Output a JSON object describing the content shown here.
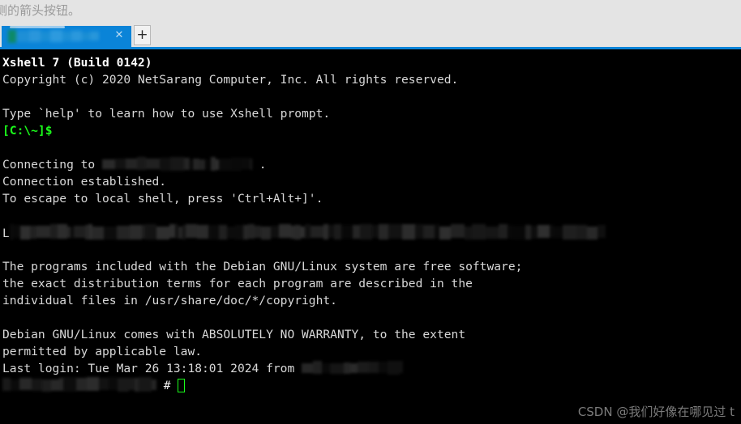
{
  "page_header": {
    "text": "侧的箭头按钮。"
  },
  "tabbar": {
    "tab": {
      "label": "",
      "close_icon": "✕"
    },
    "new_tab_label": "+",
    "accent_color": "#0a84d8"
  },
  "terminal": {
    "background_color": "#000000",
    "foreground_color": "#d8d8d8",
    "prompt_color": "#1bfc1b",
    "lines": [
      {
        "id": "l1",
        "text": "Xshell 7 (Build 0142)",
        "style": "bold"
      },
      {
        "id": "l2",
        "text": "Copyright (c) 2020 NetSarang Computer, Inc. All rights reserved.",
        "style": "normal"
      },
      {
        "id": "l3",
        "text": "",
        "style": "blank"
      },
      {
        "id": "l4",
        "text": "Type `help' to learn how to use Xshell prompt.",
        "style": "normal"
      },
      {
        "id": "l5",
        "text": "[C:\\~]$",
        "style": "green"
      },
      {
        "id": "l6",
        "text": "",
        "style": "blank"
      },
      {
        "id": "l7",
        "prefix": "Connecting to ",
        "redacted": true,
        "suffix": " .",
        "style": "normal"
      },
      {
        "id": "l8",
        "text": "Connection established.",
        "style": "normal"
      },
      {
        "id": "l9",
        "text": "To escape to local shell, press 'Ctrl+Alt+]'.",
        "style": "normal"
      },
      {
        "id": "l10",
        "text": "",
        "style": "blank"
      },
      {
        "id": "l11",
        "prefix": "L",
        "redacted": true,
        "suffix": "",
        "style": "normal"
      },
      {
        "id": "l12",
        "text": "",
        "style": "blank"
      },
      {
        "id": "l13",
        "text": "The programs included with the Debian GNU/Linux system are free software;",
        "style": "normal"
      },
      {
        "id": "l14",
        "text": "the exact distribution terms for each program are described in the",
        "style": "normal"
      },
      {
        "id": "l15",
        "text": "individual files in /usr/share/doc/*/copyright.",
        "style": "normal"
      },
      {
        "id": "l16",
        "text": "",
        "style": "blank"
      },
      {
        "id": "l17",
        "text": "Debian GNU/Linux comes with ABSOLUTELY NO WARRANTY, to the extent",
        "style": "normal"
      },
      {
        "id": "l18",
        "text": "permitted by applicable law.",
        "style": "normal"
      },
      {
        "id": "l19",
        "prefix": "Last login: Tue Mar 26 13:18:01 2024 from ",
        "redacted": true,
        "suffix": "",
        "style": "normal"
      },
      {
        "id": "l20",
        "prefix": "",
        "redacted": true,
        "suffix": " # ",
        "cursor": true,
        "style": "normal"
      }
    ],
    "prompt_symbol": "#"
  },
  "watermark": {
    "text": "CSDN @我们好像在哪见过 t"
  }
}
